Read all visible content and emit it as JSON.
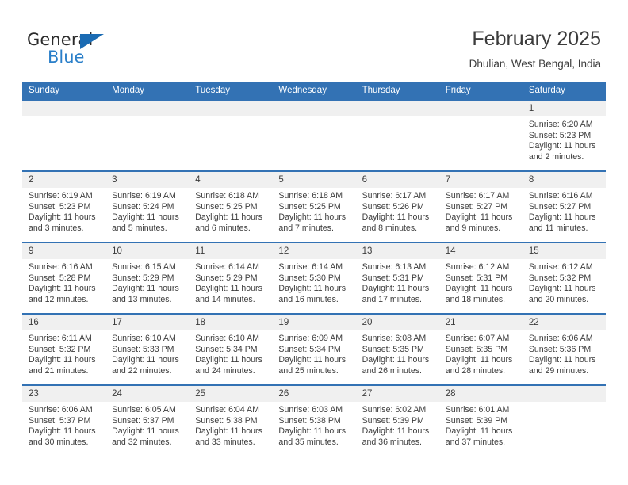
{
  "brand": {
    "word_one": "General",
    "word_two": "Blue",
    "triangle_color": "#1a6bb3",
    "blue_text_color": "#2a7fc9"
  },
  "header": {
    "title": "February 2025",
    "subtitle": "Dhulian, West Bengal, India",
    "accent_color": "#3372b4",
    "daynum_band_color": "#f0f0f0"
  },
  "weekdays": [
    "Sunday",
    "Monday",
    "Tuesday",
    "Wednesday",
    "Thursday",
    "Friday",
    "Saturday"
  ],
  "labels": {
    "sunrise": "Sunrise:",
    "sunset": "Sunset:",
    "daylight": "Daylight:"
  },
  "weeks": [
    [
      {
        "day": "",
        "l1": "",
        "l2": "",
        "l3": "",
        "l4": ""
      },
      {
        "day": "",
        "l1": "",
        "l2": "",
        "l3": "",
        "l4": ""
      },
      {
        "day": "",
        "l1": "",
        "l2": "",
        "l3": "",
        "l4": ""
      },
      {
        "day": "",
        "l1": "",
        "l2": "",
        "l3": "",
        "l4": ""
      },
      {
        "day": "",
        "l1": "",
        "l2": "",
        "l3": "",
        "l4": ""
      },
      {
        "day": "",
        "l1": "",
        "l2": "",
        "l3": "",
        "l4": ""
      },
      {
        "day": "1",
        "l1": "Sunrise: 6:20 AM",
        "l2": "Sunset: 5:23 PM",
        "l3": "Daylight: 11 hours",
        "l4": "and 2 minutes."
      }
    ],
    [
      {
        "day": "2",
        "l1": "Sunrise: 6:19 AM",
        "l2": "Sunset: 5:23 PM",
        "l3": "Daylight: 11 hours",
        "l4": "and 3 minutes."
      },
      {
        "day": "3",
        "l1": "Sunrise: 6:19 AM",
        "l2": "Sunset: 5:24 PM",
        "l3": "Daylight: 11 hours",
        "l4": "and 5 minutes."
      },
      {
        "day": "4",
        "l1": "Sunrise: 6:18 AM",
        "l2": "Sunset: 5:25 PM",
        "l3": "Daylight: 11 hours",
        "l4": "and 6 minutes."
      },
      {
        "day": "5",
        "l1": "Sunrise: 6:18 AM",
        "l2": "Sunset: 5:25 PM",
        "l3": "Daylight: 11 hours",
        "l4": "and 7 minutes."
      },
      {
        "day": "6",
        "l1": "Sunrise: 6:17 AM",
        "l2": "Sunset: 5:26 PM",
        "l3": "Daylight: 11 hours",
        "l4": "and 8 minutes."
      },
      {
        "day": "7",
        "l1": "Sunrise: 6:17 AM",
        "l2": "Sunset: 5:27 PM",
        "l3": "Daylight: 11 hours",
        "l4": "and 9 minutes."
      },
      {
        "day": "8",
        "l1": "Sunrise: 6:16 AM",
        "l2": "Sunset: 5:27 PM",
        "l3": "Daylight: 11 hours",
        "l4": "and 11 minutes."
      }
    ],
    [
      {
        "day": "9",
        "l1": "Sunrise: 6:16 AM",
        "l2": "Sunset: 5:28 PM",
        "l3": "Daylight: 11 hours",
        "l4": "and 12 minutes."
      },
      {
        "day": "10",
        "l1": "Sunrise: 6:15 AM",
        "l2": "Sunset: 5:29 PM",
        "l3": "Daylight: 11 hours",
        "l4": "and 13 minutes."
      },
      {
        "day": "11",
        "l1": "Sunrise: 6:14 AM",
        "l2": "Sunset: 5:29 PM",
        "l3": "Daylight: 11 hours",
        "l4": "and 14 minutes."
      },
      {
        "day": "12",
        "l1": "Sunrise: 6:14 AM",
        "l2": "Sunset: 5:30 PM",
        "l3": "Daylight: 11 hours",
        "l4": "and 16 minutes."
      },
      {
        "day": "13",
        "l1": "Sunrise: 6:13 AM",
        "l2": "Sunset: 5:31 PM",
        "l3": "Daylight: 11 hours",
        "l4": "and 17 minutes."
      },
      {
        "day": "14",
        "l1": "Sunrise: 6:12 AM",
        "l2": "Sunset: 5:31 PM",
        "l3": "Daylight: 11 hours",
        "l4": "and 18 minutes."
      },
      {
        "day": "15",
        "l1": "Sunrise: 6:12 AM",
        "l2": "Sunset: 5:32 PM",
        "l3": "Daylight: 11 hours",
        "l4": "and 20 minutes."
      }
    ],
    [
      {
        "day": "16",
        "l1": "Sunrise: 6:11 AM",
        "l2": "Sunset: 5:32 PM",
        "l3": "Daylight: 11 hours",
        "l4": "and 21 minutes."
      },
      {
        "day": "17",
        "l1": "Sunrise: 6:10 AM",
        "l2": "Sunset: 5:33 PM",
        "l3": "Daylight: 11 hours",
        "l4": "and 22 minutes."
      },
      {
        "day": "18",
        "l1": "Sunrise: 6:10 AM",
        "l2": "Sunset: 5:34 PM",
        "l3": "Daylight: 11 hours",
        "l4": "and 24 minutes."
      },
      {
        "day": "19",
        "l1": "Sunrise: 6:09 AM",
        "l2": "Sunset: 5:34 PM",
        "l3": "Daylight: 11 hours",
        "l4": "and 25 minutes."
      },
      {
        "day": "20",
        "l1": "Sunrise: 6:08 AM",
        "l2": "Sunset: 5:35 PM",
        "l3": "Daylight: 11 hours",
        "l4": "and 26 minutes."
      },
      {
        "day": "21",
        "l1": "Sunrise: 6:07 AM",
        "l2": "Sunset: 5:35 PM",
        "l3": "Daylight: 11 hours",
        "l4": "and 28 minutes."
      },
      {
        "day": "22",
        "l1": "Sunrise: 6:06 AM",
        "l2": "Sunset: 5:36 PM",
        "l3": "Daylight: 11 hours",
        "l4": "and 29 minutes."
      }
    ],
    [
      {
        "day": "23",
        "l1": "Sunrise: 6:06 AM",
        "l2": "Sunset: 5:37 PM",
        "l3": "Daylight: 11 hours",
        "l4": "and 30 minutes."
      },
      {
        "day": "24",
        "l1": "Sunrise: 6:05 AM",
        "l2": "Sunset: 5:37 PM",
        "l3": "Daylight: 11 hours",
        "l4": "and 32 minutes."
      },
      {
        "day": "25",
        "l1": "Sunrise: 6:04 AM",
        "l2": "Sunset: 5:38 PM",
        "l3": "Daylight: 11 hours",
        "l4": "and 33 minutes."
      },
      {
        "day": "26",
        "l1": "Sunrise: 6:03 AM",
        "l2": "Sunset: 5:38 PM",
        "l3": "Daylight: 11 hours",
        "l4": "and 35 minutes."
      },
      {
        "day": "27",
        "l1": "Sunrise: 6:02 AM",
        "l2": "Sunset: 5:39 PM",
        "l3": "Daylight: 11 hours",
        "l4": "and 36 minutes."
      },
      {
        "day": "28",
        "l1": "Sunrise: 6:01 AM",
        "l2": "Sunset: 5:39 PM",
        "l3": "Daylight: 11 hours",
        "l4": "and 37 minutes."
      },
      {
        "day": "",
        "l1": "",
        "l2": "",
        "l3": "",
        "l4": ""
      }
    ]
  ]
}
